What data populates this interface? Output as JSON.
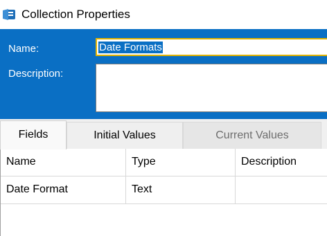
{
  "window": {
    "title": "Collection Properties",
    "icon": "collection-icon"
  },
  "properties": {
    "name_label": "Name:",
    "name_value": "Date Formats",
    "description_label": "Description:",
    "description_value": ""
  },
  "tabs": [
    {
      "label": "Fields",
      "state": "selected"
    },
    {
      "label": "Initial Values",
      "state": "normal"
    },
    {
      "label": "Current Values",
      "state": "disabled"
    }
  ],
  "grid": {
    "columns": [
      "Name",
      "Type",
      "Description"
    ],
    "rows": [
      [
        "Date Format",
        "Text",
        ""
      ]
    ]
  },
  "colors": {
    "panel_blue": "#0a6fc4",
    "focus_border": "#e4b400"
  }
}
